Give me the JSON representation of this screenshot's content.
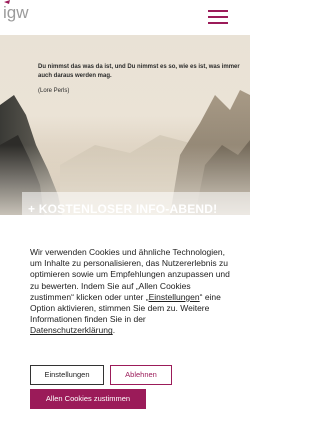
{
  "header": {
    "logo_text": "igw",
    "menu_icon": "hamburger-menu-icon",
    "accent_color": "#9b1b59"
  },
  "hero": {
    "quote": "Du nimmst das was da ist, und Du nimmst es so, wie es ist, was immer auch daraus werden mag.",
    "author": "(Lore Perls)",
    "cta_plus": "+",
    "cta_label": "KOSTENLOSER INFO-ABEND!"
  },
  "cookie": {
    "text_main": "Wir verwenden Cookies und ähnliche Technologien, um Inhalte zu personalisieren, das Nutzererlebnis zu optimieren sowie um Empfehlungen anzupassen und zu bewerten. Indem Sie auf „Allen Cookies zustimmen“ klicken oder unter „",
    "settings_link": "Einstellungen",
    "text_middle": "“ eine Option aktivieren, stimmen Sie dem zu. Weitere Informationen finden Sie in der ",
    "privacy_link": "Datenschutzerklärung",
    "text_end": ".",
    "btn_settings": "Einstellungen",
    "btn_reject": "Ablehnen",
    "btn_accept": "Allen Cookies zustimmen"
  }
}
